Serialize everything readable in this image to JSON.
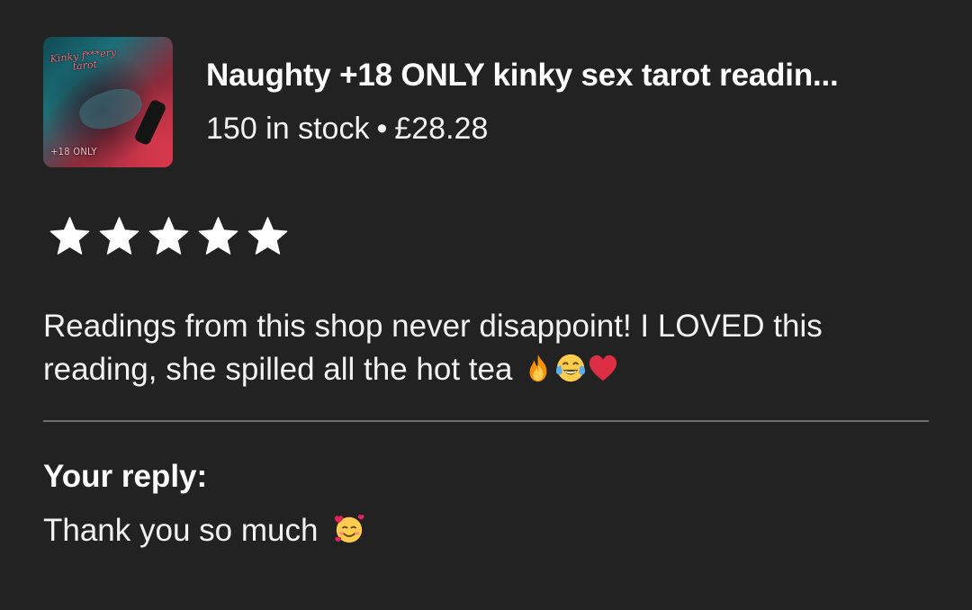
{
  "product": {
    "title": "Naughty +18 ONLY kinky sex tarot readin...",
    "stock": "150 in stock",
    "separator": "•",
    "price": "£28.28",
    "thumbnail": {
      "title_line1": "Kinky f***ery",
      "title_line2": "tarot",
      "badge": "+18 ONLY",
      "colors": [
        "#0f4a54",
        "#1c6f78",
        "#8a2a3a",
        "#d8364a"
      ]
    }
  },
  "review": {
    "rating": 5,
    "max_rating": 5,
    "star_color": "#ffffff",
    "text": "Readings from this shop never disappoint! I LOVED this reading, she spilled all the hot tea",
    "emojis": [
      "fire-emoji",
      "tears-of-joy-emoji",
      "red-heart-emoji"
    ]
  },
  "reply": {
    "label": "Your reply:",
    "text": "Thank you so much",
    "emoji": "smiling-face-with-hearts-emoji"
  },
  "colors": {
    "background": "#222222",
    "divider": "#6e6e6e",
    "text": "#ffffff"
  }
}
